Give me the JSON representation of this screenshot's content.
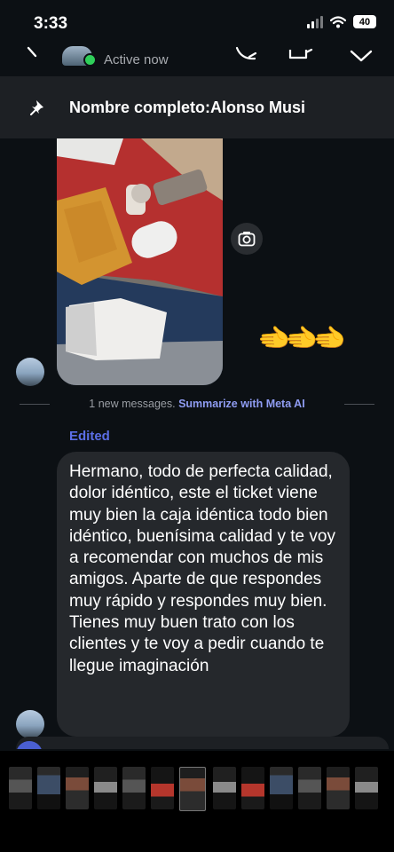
{
  "status_bar": {
    "time": "3:33",
    "battery": "40"
  },
  "header": {
    "status": "Active now"
  },
  "pinned": {
    "text": "Nombre completo:Alonso Musi"
  },
  "divider": {
    "count_text": "1 new messages.",
    "link_text": "Summarize with Meta AI"
  },
  "message": {
    "edited_label": "Edited",
    "text": "Hermano, todo de perfecta calidad, dolor idéntico, este el ticket viene muy bien la caja idéntica todo bien idéntico, buenísima calidad y te voy a recomendar con muchos de mis amigos. Aparte de que respondes muy rápido y respondes muy bien. Tienes muy buen trato con los clientes y te voy a pedir cuando te llegue imaginación"
  },
  "reaction": {
    "emoji": "🫲🫲🫲"
  },
  "icons": {
    "back": "chevron-left-icon",
    "call": "phone-icon",
    "video": "video-camera-icon",
    "more": "chevron-down-icon",
    "pin": "pin-icon",
    "share": "camera-icon"
  },
  "colors": {
    "background": "#0c1014",
    "bubble": "#25282c",
    "accent": "#5b6ee6",
    "link": "#8f9cf2",
    "online": "#2fcf5a"
  }
}
